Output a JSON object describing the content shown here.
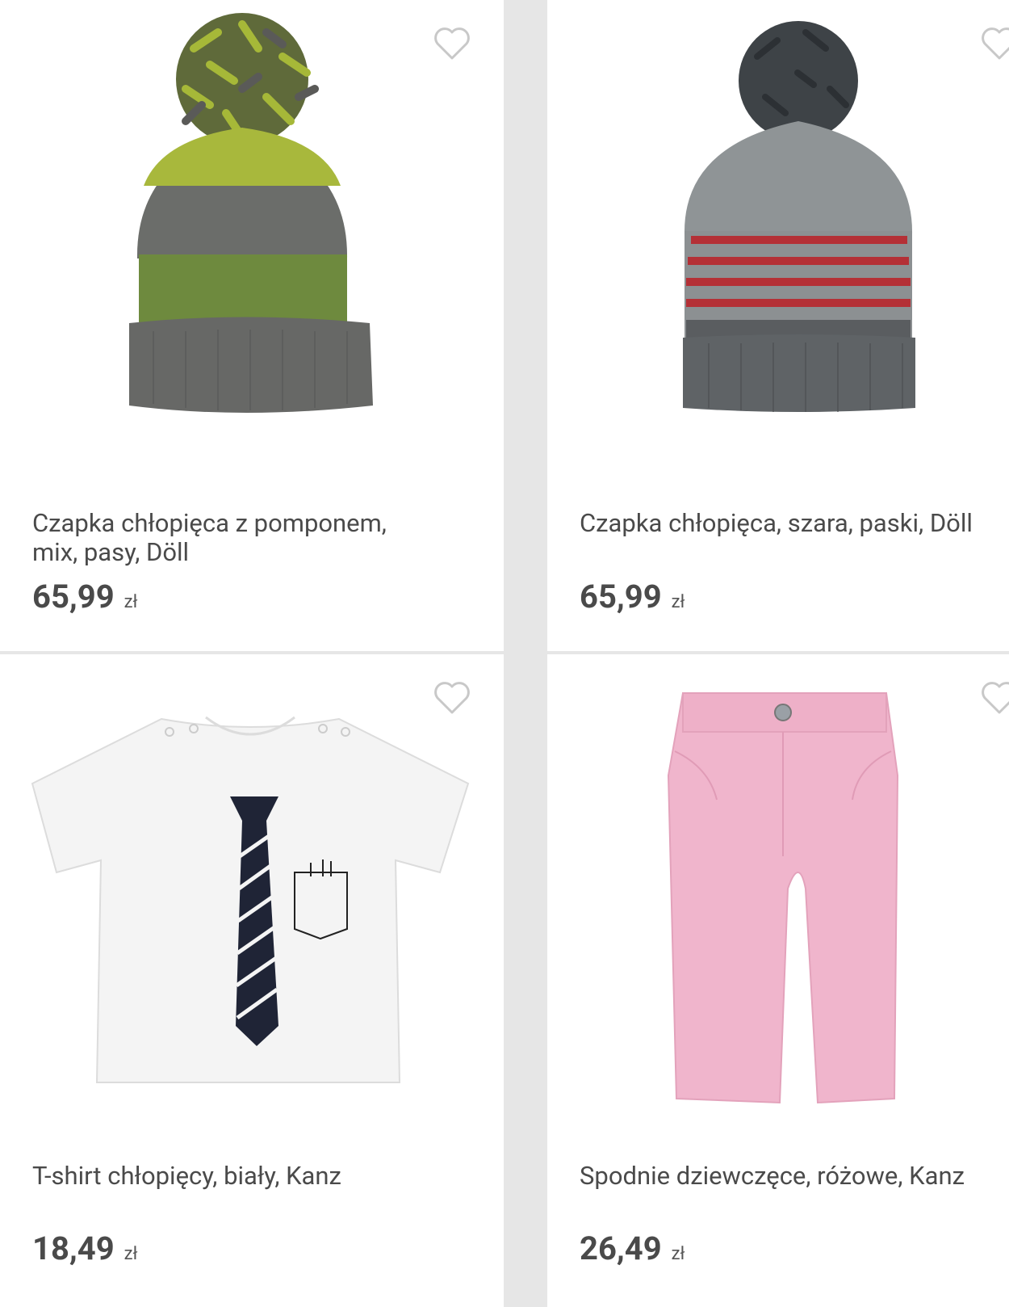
{
  "products": [
    {
      "name": "Czapka chłopięca z pomponem,\nmix, pasy, Döll",
      "price": "65,99",
      "currency": "zł",
      "image": "hat-green-grey-pompom"
    },
    {
      "name": "Czapka chłopięca, szara, paski, Döll",
      "price": "65,99",
      "currency": "zł",
      "image": "hat-grey-red-stripes-pompom"
    },
    {
      "name": "T-shirt chłopięcy, biały, Kanz",
      "price": "18,49",
      "currency": "zł",
      "image": "white-tshirt-tie-print"
    },
    {
      "name": "Spodnie dziewczęce, różowe, Kanz",
      "price": "26,49",
      "currency": "zł",
      "image": "pink-trousers"
    }
  ],
  "icons": {
    "favorite": "heart-outline-icon"
  },
  "colors": {
    "text": "#4a4a4a",
    "divider": "#e6e6e6",
    "heart": "#c8c8c8"
  }
}
